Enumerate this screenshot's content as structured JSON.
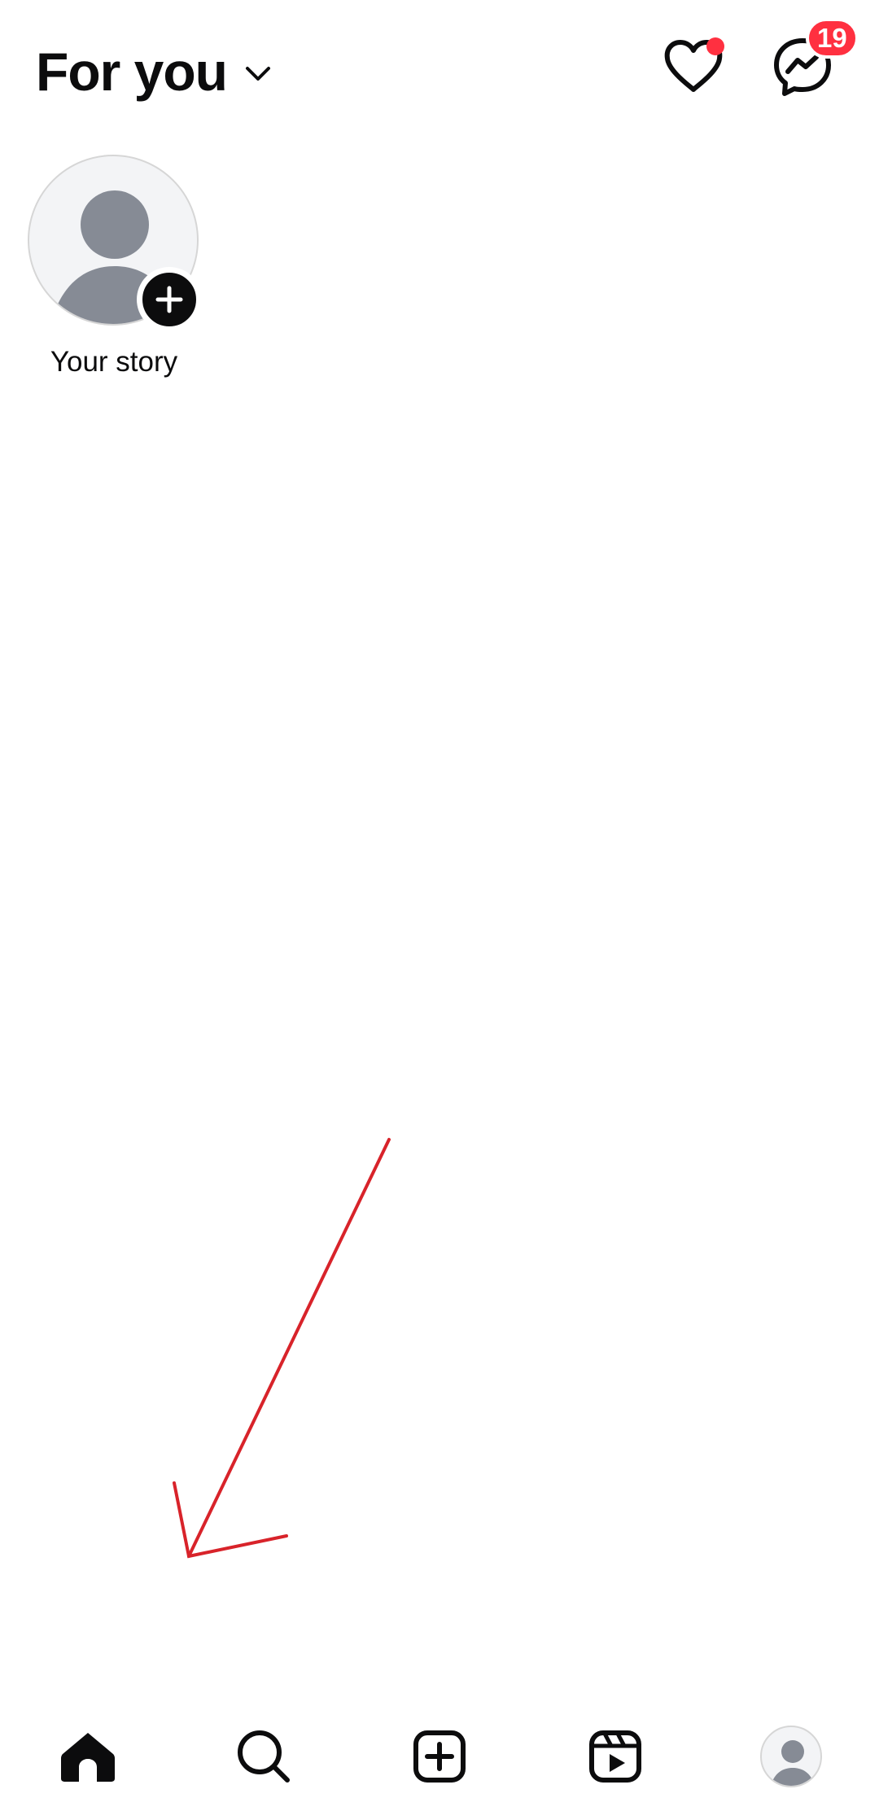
{
  "header": {
    "feed_title": "For you",
    "icons": {
      "feed_dropdown": "chevron-down-icon",
      "notifications": "heart-icon",
      "messages": "messenger-icon"
    },
    "notifications_has_dot": true,
    "messages_badge_count": "19"
  },
  "stories": [
    {
      "label": "Your story",
      "icon": "avatar-placeholder-icon",
      "add_icon": "plus-icon"
    }
  ],
  "bottom_nav": {
    "items": [
      {
        "name": "home",
        "icon": "home-icon",
        "active": true
      },
      {
        "name": "search",
        "icon": "search-icon",
        "active": false
      },
      {
        "name": "create",
        "icon": "add-post-icon",
        "active": false
      },
      {
        "name": "reels",
        "icon": "reels-icon",
        "active": false
      },
      {
        "name": "profile",
        "icon": "avatar-icon",
        "active": false
      }
    ]
  },
  "colors": {
    "text": "#0c0c0d",
    "badge": "#ff3040",
    "avatar_bg": "#f3f4f6",
    "avatar_figure": "#868b95",
    "annotation": "#d8232a"
  }
}
